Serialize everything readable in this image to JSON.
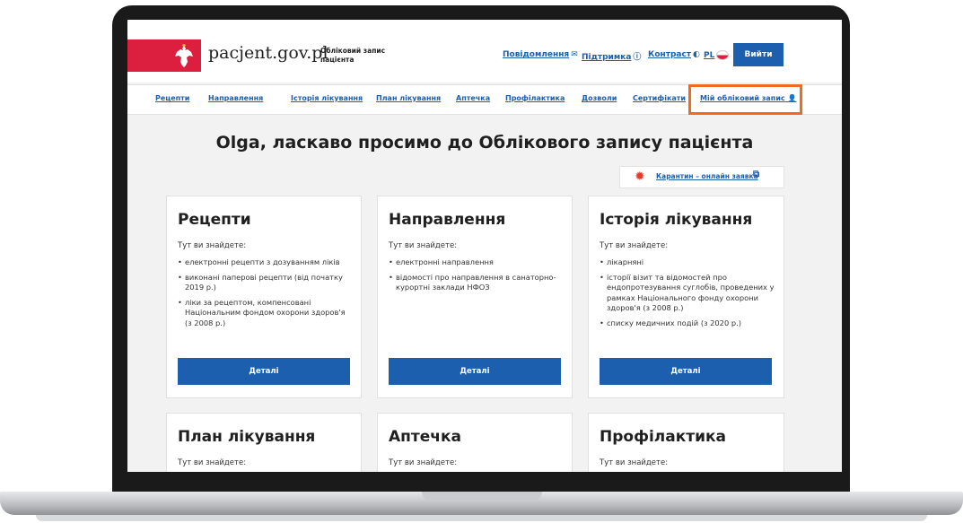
{
  "header": {
    "logo": "pacjent.gov.pl",
    "logo_sub": "Обліковий запис пацієнта",
    "links": {
      "notifications": "Повідомлення",
      "support": "Підтримка",
      "contrast": "Контраст",
      "language": "PL"
    },
    "logout": "Вийти"
  },
  "nav": {
    "items": [
      "Рецепти",
      "Направлення",
      "Історія лікування",
      "План лікування",
      "Аптечка",
      "Профілактика",
      "Дозволи",
      "Сертифікати",
      "Мій обліковий запис"
    ]
  },
  "welcome": "Olga, ласкаво просимо до Облікового запису пацієнта",
  "quarantine": "Карантин – онлайн заявка",
  "cards": [
    {
      "title": "Рецепти",
      "intro": "Тут ви знайдете:",
      "items": [
        "електронні рецепти з дозуванням ліків",
        "виконані паперові рецепти (від початку 2019 р.)",
        "ліки за рецептом, компенсовані Національним фондом охорони здоров'я (з 2008 р.)"
      ],
      "button": "Деталі"
    },
    {
      "title": "Направлення",
      "intro": "Тут ви знайдете:",
      "items": [
        "електронні направлення",
        "відомості про направлення в санаторно-курортні заклади НФОЗ"
      ],
      "button": "Деталі"
    },
    {
      "title": "Історія лікування",
      "intro": "Тут ви знайдете:",
      "items": [
        "лікарняні",
        "історії візит та відомостей про ендопротезування суглобів, проведених у рамках Національного фонду охорони здоров'я (з 2008 р.)",
        "списку медичних подій (з 2020 р.)"
      ],
      "button": "Деталі"
    },
    {
      "title": "План лікування",
      "intro": "Тут ви знайдете:"
    },
    {
      "title": "Аптечка",
      "intro": "Тут ви знайдете:"
    },
    {
      "title": "Профілактика",
      "intro": "Тут ви знайдете:"
    }
  ],
  "colors": {
    "accent": "#1c5fae",
    "highlight": "#f06a1f",
    "flag_red": "#dc1f3e"
  }
}
